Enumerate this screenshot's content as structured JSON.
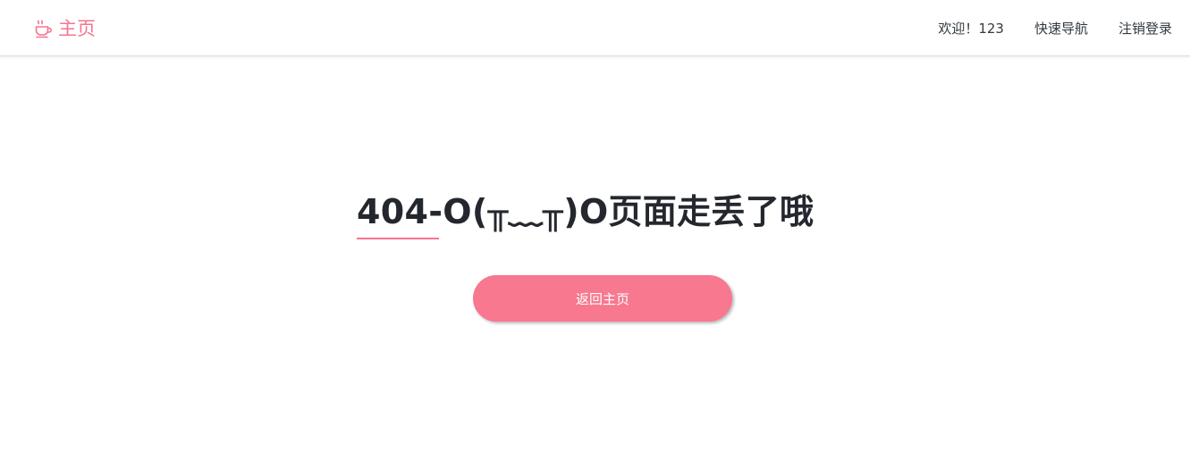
{
  "header": {
    "brand_label": "主页",
    "brand_icon": "coffee-cup-icon",
    "brand_color": "#f7748f",
    "welcome_text": "欢迎！123",
    "quick_nav_label": "快速导航",
    "logout_label": "注销登录"
  },
  "main": {
    "title": "404-O(╥﹏╥)O页面走丢了哦",
    "button_label": "返回主页",
    "accent_color": "#f7788f"
  }
}
